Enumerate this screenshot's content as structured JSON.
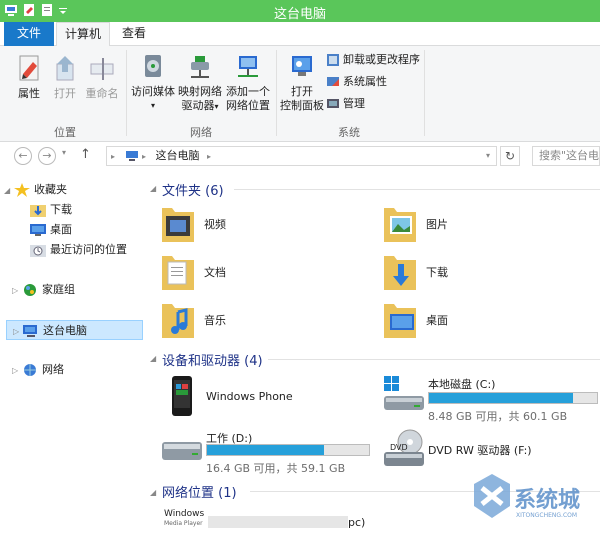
{
  "window": {
    "title": "这台电脑"
  },
  "tabs": [
    {
      "label": "文件"
    },
    {
      "label": "计算机"
    },
    {
      "label": "查看"
    }
  ],
  "ribbon": {
    "properties": "属性",
    "open": "打开",
    "rename": "重命名",
    "location_group": "位置",
    "access_media": "访问媒体",
    "map_drive_line1": "映射网络",
    "map_drive_line2": "驱动器",
    "add_location_line1": "添加一个",
    "add_location_line2": "网络位置",
    "network_group": "网络",
    "control_panel_line1": "打开",
    "control_panel_line2": "控制面板",
    "uninstall": "卸载或更改程序",
    "sys_props": "系统属性",
    "manage": "管理",
    "system_group": "系统"
  },
  "address": {
    "path": "这台电脑",
    "search_placeholder": "搜索\"这台电脑\""
  },
  "nav": {
    "favorites": "收藏夹",
    "downloads": "下载",
    "desktop": "桌面",
    "recent": "最近访问的位置",
    "homegroup": "家庭组",
    "thispc": "这台电脑",
    "network": "网络"
  },
  "sections": {
    "folders": "文件夹 (6)",
    "devices": "设备和驱动器 (4)",
    "netlocs": "网络位置 (1)"
  },
  "folders": [
    {
      "label": "视频"
    },
    {
      "label": "图片"
    },
    {
      "label": "文档"
    },
    {
      "label": "下载"
    },
    {
      "label": "音乐"
    },
    {
      "label": "桌面"
    }
  ],
  "drives": {
    "phone": {
      "label": "Windows Phone"
    },
    "c": {
      "label": "本地磁盘 (C:)",
      "free": "8.48 GB 可用，共 60.1 GB",
      "used_fraction": 0.86
    },
    "d": {
      "label": "工作 (D:)",
      "free": "16.4 GB 可用，共 59.1 GB",
      "used_fraction": 0.72
    },
    "dvd": {
      "label": "DVD RW 驱动器 (F:)"
    }
  },
  "netloc": {
    "label_suffix": "pc)",
    "logo_line1": "Windows",
    "logo_line2": "Media Player"
  },
  "watermark": {
    "text": "系统城",
    "sub": "XITONGCHENG.COM"
  },
  "colors": {
    "titlebar": "#5ac65a",
    "file_tab": "#1979ca",
    "section": "#1e3287",
    "bar": "#26a0da"
  }
}
